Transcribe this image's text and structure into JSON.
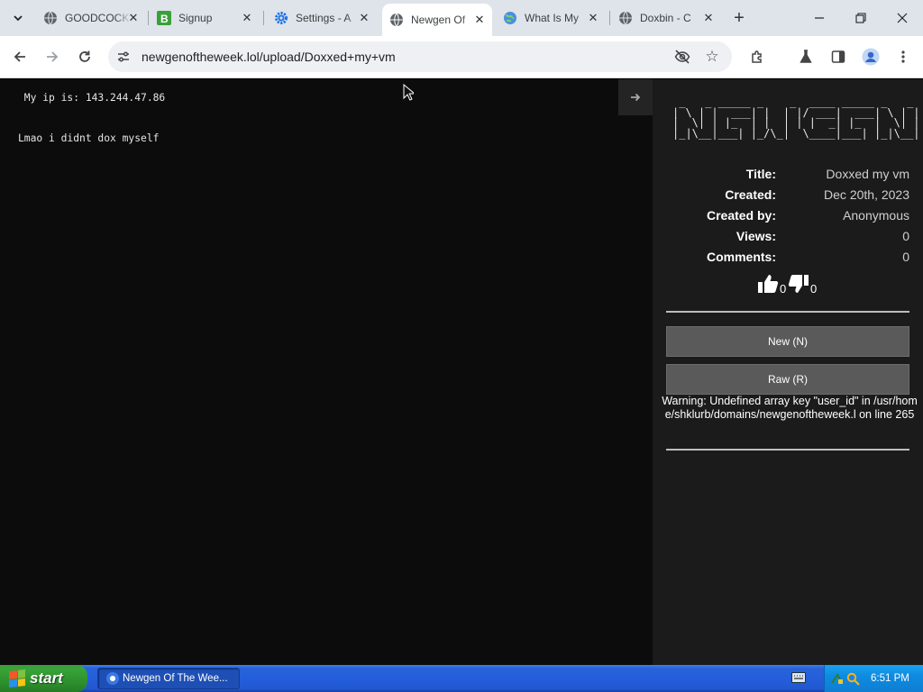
{
  "browser": {
    "tabs": [
      {
        "title": "GOODCOCK",
        "icon": "globe-icon",
        "active": false
      },
      {
        "title": "Signup",
        "icon": "b-favicon-icon",
        "active": false
      },
      {
        "title": "Settings - A",
        "icon": "gear-icon",
        "active": false
      },
      {
        "title": "Newgen Of",
        "icon": "globe-icon",
        "active": true
      },
      {
        "title": "What Is My",
        "icon": "world-favicon-icon",
        "active": false
      },
      {
        "title": "Doxbin - C",
        "icon": "globe-icon",
        "active": false
      }
    ],
    "address": "newgenoftheweek.lol/upload/Doxxed+my+vm",
    "accent": "#dfe3ea"
  },
  "paste": {
    "text": " My ip is: 143.244.47.86\n\n\nLmao i didnt dox myself"
  },
  "sidebar": {
    "logo_ascii": " _   _ _____ _    _  ____ _____ _   _ \n| \\ | |  ___| |  | |/ ___|  ___| \\ | |\n|  \\| | |_  | |  | | |  _| |_  |  \\| |\n|_|\\__|___| |_/\\_|  \\____|___| |_|\\__|",
    "meta": [
      {
        "label": "Title:",
        "value": "Doxxed my vm"
      },
      {
        "label": "Created:",
        "value": "Dec 20th, 2023"
      },
      {
        "label": "Created by:",
        "value": "Anonymous"
      },
      {
        "label": "Views:",
        "value": "0"
      },
      {
        "label": "Comments:",
        "value": "0"
      }
    ],
    "likes": "0",
    "dislikes": "0",
    "new_button": "New (N)",
    "raw_button": "Raw (R)",
    "warning": "Warning: Undefined array key \"user_id\" in /usr/home/shklurb/domains/newgenoftheweek.l on line 265"
  },
  "taskbar": {
    "start_label": "start",
    "app_label": "Newgen Of The Wee...",
    "clock": "6:51 PM"
  }
}
